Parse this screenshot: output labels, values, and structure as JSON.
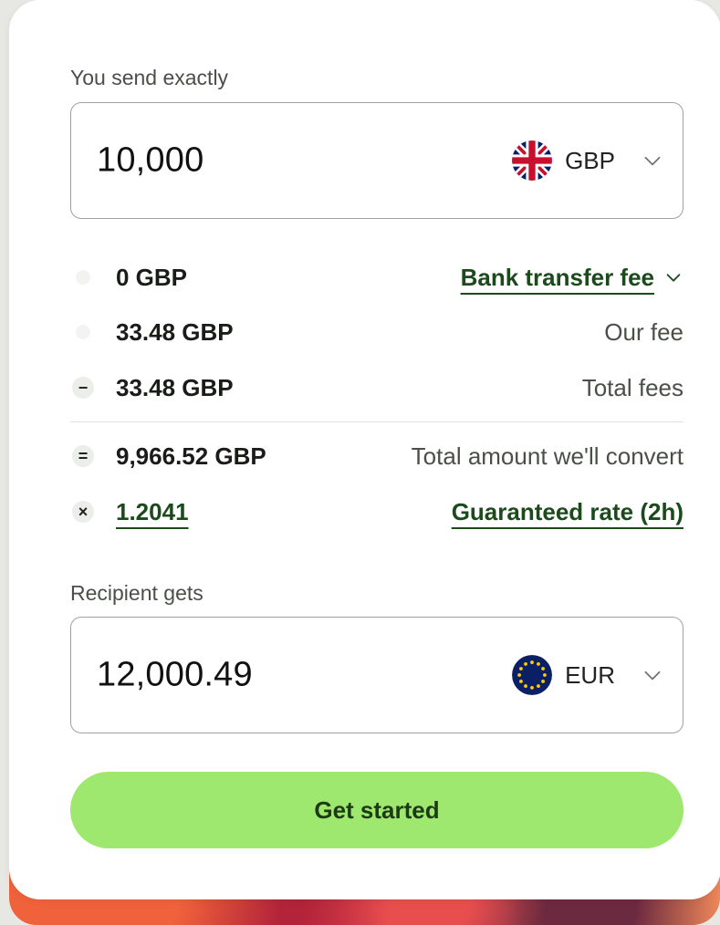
{
  "send": {
    "label": "You send exactly",
    "amount": "10,000",
    "currency": "GBP",
    "flag_icon": "uk-flag-icon"
  },
  "fees": {
    "bank_transfer": {
      "value": "0 GBP",
      "label": "Bank transfer fee"
    },
    "our_fee": {
      "value": "33.48 GBP",
      "label": "Our fee"
    },
    "total_fees": {
      "operator": "−",
      "value": "33.48 GBP",
      "label": "Total fees"
    },
    "convert": {
      "operator": "=",
      "value": "9,966.52 GBP",
      "label": "Total amount we'll convert"
    },
    "rate": {
      "operator": "×",
      "value": "1.2041",
      "label": "Guaranteed rate (2h)"
    }
  },
  "receive": {
    "label": "Recipient gets",
    "amount": "12,000.49",
    "currency": "EUR",
    "flag_icon": "eu-flag-icon"
  },
  "cta": {
    "label": "Get started"
  },
  "colors": {
    "accent_green": "#9fe870",
    "link_green": "#1d4a1d",
    "card": "#ffffff"
  }
}
